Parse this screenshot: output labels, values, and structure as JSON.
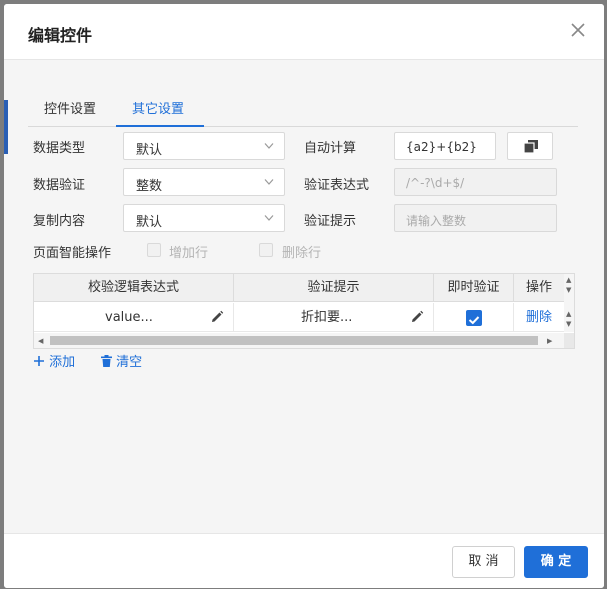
{
  "dialog": {
    "title": "编辑控件"
  },
  "tabs": [
    {
      "label": "控件设置"
    },
    {
      "label": "其它设置"
    }
  ],
  "form": {
    "data_type": {
      "label": "数据类型",
      "value": "默认"
    },
    "data_validate": {
      "label": "数据验证",
      "value": "整数"
    },
    "copy_content": {
      "label": "复制内容",
      "value": "默认"
    },
    "auto_calc": {
      "label": "自动计算",
      "value": "{a2}+{b2}"
    },
    "validate_expr": {
      "label": "验证表达式",
      "value": "/^-?\\d+$/"
    },
    "validate_tip": {
      "label": "验证提示",
      "placeholder": "请输入整数"
    },
    "smart_ops": {
      "label": "页面智能操作",
      "add_row": "增加行",
      "del_row": "删除行"
    }
  },
  "grid": {
    "columns": [
      "校验逻辑表达式",
      "验证提示",
      "即时验证",
      "操作"
    ],
    "rows": [
      {
        "expr": "value...",
        "tip": "折扣要...",
        "instant": true,
        "action": "删除"
      }
    ]
  },
  "actions": {
    "add": "添加",
    "clear": "清空"
  },
  "footer": {
    "cancel": "取 消",
    "ok": "确 定"
  },
  "colors": {
    "accent": "#1f6fd8"
  }
}
